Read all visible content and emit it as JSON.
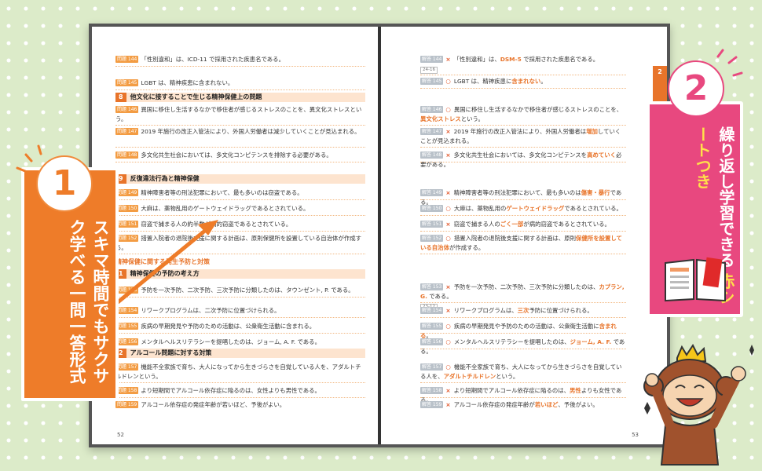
{
  "left_page": {
    "page_number": "52",
    "rows": [
      {
        "tag": "問題 144",
        "text": "「性別違和」は、ICD-11 で採用された疾患名である。"
      },
      {
        "tag": "問題 145",
        "text": "LGBT は、精神疾患に含まれない。"
      },
      {
        "tag": "問題 146",
        "text": "異国に移住し生活するなかで移住者が感じるストレスのことを、異文化ストレスという。"
      },
      {
        "tag": "問題 147",
        "text": "2019 年施行の改正入管法により、外国人労働者は減少していくことが見込まれる。"
      },
      {
        "tag": "問題 148",
        "text": "多文化共生社会においては、多文化コンピテンスを排除する必要がある。"
      },
      {
        "tag": "問題 149",
        "text": "精神障害者等の刑法犯罪において、最も多いのは窃盗である。"
      },
      {
        "tag": "問題 150",
        "text": "大麻は、薬物乱用のゲートウェイドラッグであるとされている。"
      },
      {
        "tag": "問題 151",
        "text": "窃盗で捕まる人の約半数が病的窃盗であるとされている。"
      },
      {
        "tag": "問題 152",
        "text": "措置入院者の退院後支援に関する計画は、原則保健所を設置している自治体が作成する。"
      },
      {
        "tag": "問題 153",
        "text": "予防を一次予防、二次予防、三次予防に分類したのは、タウンゼント, P. である。"
      },
      {
        "tag": "問題 154",
        "text": "リワークプログラムは、二次予防に位置づけられる。"
      },
      {
        "tag": "問題 155",
        "text": "疾病の早期発見や予防のための活動は、公衆衛生活動に含まれる。"
      },
      {
        "tag": "問題 156",
        "text": "メンタルヘルスリテラシーを提唱したのは、ジョーム, A. F. である。"
      },
      {
        "tag": "問題 157",
        "text": "機能不全家族で育ち、大人になってから生きづらさを自覚している人を、アダルトチルドレンという。"
      },
      {
        "tag": "問題 158",
        "text": "より短期間でアルコール依存症に陥るのは、女性よりも男性である。"
      },
      {
        "tag": "問題 159",
        "text": "アルコール依存症の発症年齢が若いほど、予後がよい。"
      }
    ],
    "sections": [
      {
        "num": "8",
        "title": "他文化に接することで生じる精神保健上の問題"
      },
      {
        "num": "9",
        "title": "反復違法行為と精神保健"
      },
      {
        "num": "",
        "title": "精神保健に関する発生予防と対策"
      },
      {
        "num": "1",
        "title": "精神保健の予防の考え方"
      },
      {
        "num": "2",
        "title": "アルコール問題に対する対策"
      }
    ]
  },
  "right_page": {
    "page_number": "53",
    "chapter_tab": "2",
    "rows": [
      {
        "tag": "解答 144",
        "mark": "×",
        "pre": "「性別違和」は、",
        "hl": "DSM-5",
        "post": " で採用された疾患名である。",
        "ref": "24-16"
      },
      {
        "tag": "解答 145",
        "mark": "○",
        "pre": "LGBT は、精神疾患に",
        "hl": "含まれない",
        "post": "。"
      },
      {
        "tag": "解答 146",
        "mark": "○",
        "pre": "異国に移住し生活するなかで移住者が感じるストレスのことを、",
        "hl": "異文化ストレス",
        "post": "という。"
      },
      {
        "tag": "解答 147",
        "mark": "×",
        "pre": "2019 年施行の改正入管法により、外国人労働者は",
        "hl": "増加",
        "post": "していくことが見込まれる。"
      },
      {
        "tag": "解答 148",
        "mark": "×",
        "pre": "多文化共生社会においては、多文化コンピテンスを",
        "hl": "高めていく",
        "post": "必要がある。"
      },
      {
        "tag": "解答 149",
        "mark": "×",
        "pre": "精神障害者等の刑法犯罪において、最も多いのは",
        "hl": "傷害・暴行",
        "post": "である。"
      },
      {
        "tag": "解答 150",
        "mark": "○",
        "pre": "大麻は、薬物乱用の",
        "hl": "ゲートウェイドラッグ",
        "post": "であるとされている。"
      },
      {
        "tag": "解答 151",
        "mark": "×",
        "pre": "窃盗で捕まる人の",
        "hl": "ごく一部",
        "post": "が病的窃盗であるとされている。"
      },
      {
        "tag": "解答 152",
        "mark": "○",
        "pre": "措置入院者の退院後支援に関する計画は、原則",
        "hl": "保健所を設置している自治体",
        "post": "が作成する。"
      },
      {
        "tag": "解答 153",
        "mark": "×",
        "pre": "予防を一次予防、二次予防、三次予防に分類したのは、",
        "hl": "カプラン, G.",
        "post": " である。",
        "ref": "23-12"
      },
      {
        "tag": "解答 154",
        "mark": "×",
        "pre": "リワークプログラムは、",
        "hl": "三次",
        "post": "予防に位置づけられる。"
      },
      {
        "tag": "解答 155",
        "mark": "○",
        "pre": "疾病の早期発見や予防のための活動は、公衆衛生活動に",
        "hl": "含まれる",
        "post": "。"
      },
      {
        "tag": "解答 156",
        "mark": "○",
        "pre": "メンタルヘルスリテラシーを提唱したのは、",
        "hl": "ジョーム, A. F.",
        "post": " である。"
      },
      {
        "tag": "解答 157",
        "mark": "○",
        "pre": "機能不全家族で育ち、大人になってから生きづらさを自覚している人を、",
        "hl": "アダルトチルドレン",
        "post": "という。"
      },
      {
        "tag": "解答 158",
        "mark": "×",
        "pre": "より短期間でアルコール依存症に陥るのは、",
        "hl": "男性",
        "post": "よりも女性である。"
      },
      {
        "tag": "解答 159",
        "mark": "×",
        "pre": "アルコール依存症の発症年齢が",
        "hl": "若いほど",
        "post": "、予後がよい。"
      }
    ]
  },
  "badge1": {
    "number": "1",
    "text": "スキマ時間でもサクサク学べる一問一答形式"
  },
  "badge2": {
    "number": "2",
    "line1": "繰り返し学習できる",
    "line2": "赤シートつき"
  },
  "colors": {
    "orange": "#ee7c29",
    "pink": "#e8487f",
    "green_bg": "#dcebc9",
    "yellow": "#ffe04a"
  }
}
